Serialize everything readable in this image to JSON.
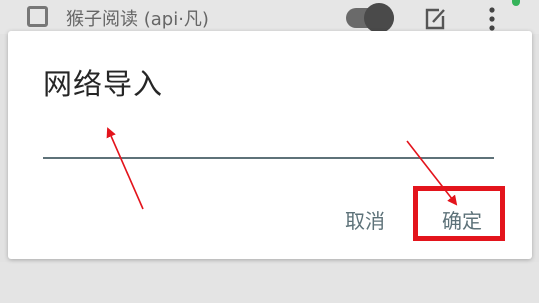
{
  "background": {
    "item_title": "猴子阅读 (api·凡)",
    "switch_on": true
  },
  "dialog": {
    "title": "网络导入",
    "input_value": "",
    "cancel_label": "取消",
    "ok_label": "确定"
  },
  "colors": {
    "accent": "#5d7279",
    "annotation": "#e3141c",
    "status_dot": "#36b35a"
  }
}
